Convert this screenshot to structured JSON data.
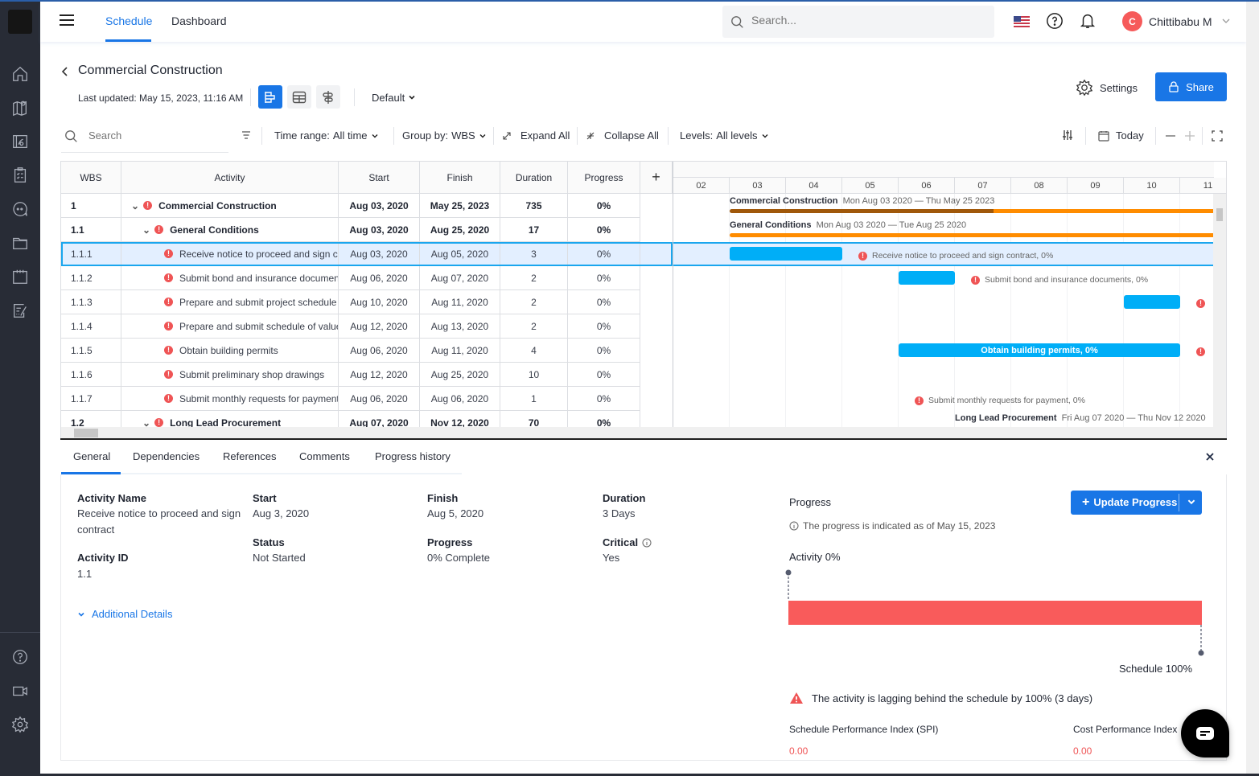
{
  "topnav": {
    "tabs": [
      {
        "label": "Schedule",
        "active": true
      },
      {
        "label": "Dashboard",
        "active": false
      }
    ],
    "search_placeholder": "Search...",
    "user": {
      "initial": "C",
      "name": "Chittibabu M"
    },
    "icons": [
      "flag-us-icon",
      "help-icon",
      "bell-icon"
    ]
  },
  "sidebar": {
    "items": [
      "home-icon",
      "map-icon",
      "blueprint-icon",
      "checklist-icon",
      "chat-icon",
      "folder-icon",
      "calendar-icon",
      "report-icon"
    ],
    "bottom_items": [
      "help-icon",
      "video-icon",
      "gear-icon"
    ]
  },
  "header": {
    "title": "Commercial Construction",
    "last_updated": "Last updated: May 15, 2023, 11:16 AM",
    "view_modes": [
      "gantt",
      "table",
      "timeline"
    ],
    "active_view": "gantt",
    "view_select": "Default",
    "settings_label": "Settings",
    "share_label": "Share"
  },
  "toolbar": {
    "search_placeholder": "Search",
    "time_range": {
      "label": "Time range:",
      "value": "All time"
    },
    "group_by": {
      "label": "Group by:",
      "value": "WBS"
    },
    "expand_all": "Expand All",
    "collapse_all": "Collapse All",
    "levels": {
      "label": "Levels:",
      "value": "All levels"
    },
    "today": "Today"
  },
  "table": {
    "columns": [
      "WBS",
      "Activity",
      "Start",
      "Finish",
      "Duration",
      "Progress"
    ],
    "rows": [
      {
        "wbs": "1",
        "activity": "Commercial Construction",
        "start": "Aug 03, 2020",
        "finish": "May 25, 2023",
        "duration": "735",
        "progress": "0%",
        "level": 0,
        "summary": true
      },
      {
        "wbs": "1.1",
        "activity": "General Conditions",
        "start": "Aug 03, 2020",
        "finish": "Aug 25, 2020",
        "duration": "17",
        "progress": "0%",
        "level": 1,
        "summary": true
      },
      {
        "wbs": "1.1.1",
        "activity": "Receive notice to proceed and sign contract",
        "start": "Aug 03, 2020",
        "finish": "Aug 05, 2020",
        "duration": "3",
        "progress": "0%",
        "level": 2,
        "selected": true
      },
      {
        "wbs": "1.1.2",
        "activity": "Submit bond and insurance documents",
        "start": "Aug 06, 2020",
        "finish": "Aug 07, 2020",
        "duration": "2",
        "progress": "0%",
        "level": 2
      },
      {
        "wbs": "1.1.3",
        "activity": "Prepare and submit project schedule",
        "start": "Aug 10, 2020",
        "finish": "Aug 11, 2020",
        "duration": "2",
        "progress": "0%",
        "level": 2
      },
      {
        "wbs": "1.1.4",
        "activity": "Prepare and submit schedule of values",
        "start": "Aug 12, 2020",
        "finish": "Aug 13, 2020",
        "duration": "2",
        "progress": "0%",
        "level": 2
      },
      {
        "wbs": "1.1.5",
        "activity": "Obtain building permits",
        "start": "Aug 06, 2020",
        "finish": "Aug 11, 2020",
        "duration": "4",
        "progress": "0%",
        "level": 2
      },
      {
        "wbs": "1.1.6",
        "activity": "Submit preliminary shop drawings",
        "start": "Aug 12, 2020",
        "finish": "Aug 25, 2020",
        "duration": "10",
        "progress": "0%",
        "level": 2
      },
      {
        "wbs": "1.1.7",
        "activity": "Submit monthly requests for payment",
        "start": "Aug 06, 2020",
        "finish": "Aug 06, 2020",
        "duration": "1",
        "progress": "0%",
        "level": 2
      },
      {
        "wbs": "1.2",
        "activity": "Long Lead Procurement",
        "start": "Aug 07, 2020",
        "finish": "Nov 12, 2020",
        "duration": "70",
        "progress": "0%",
        "level": 1,
        "summary": true
      }
    ]
  },
  "gantt": {
    "days": [
      "02",
      "03",
      "04",
      "05",
      "06",
      "07",
      "08",
      "09",
      "10",
      "11"
    ],
    "labels": {
      "cc_name": "Commercial Construction",
      "cc_dates": "Mon Aug 03 2020 — Thu May 25 2023",
      "gc_name": "General Conditions",
      "gc_dates": "Mon Aug 03 2020 — Tue Aug 25 2020",
      "t1": "Receive notice to proceed and sign contract, 0%",
      "t2": "Submit bond and insurance documents, 0%",
      "t5": "Obtain building permits, 0%",
      "t7": "Submit monthly requests for payment, 0%",
      "llp_name": "Long Lead Procurement",
      "llp_dates": "Fri Aug 07 2020 — Thu Nov 12 2020"
    }
  },
  "details": {
    "tabs": [
      "General",
      "Dependencies",
      "References",
      "Comments",
      "Progress history"
    ],
    "active_tab": "General",
    "fields": {
      "activity_name_label": "Activity Name",
      "activity_name": "Receive notice to proceed and sign contract",
      "activity_id_label": "Activity ID",
      "activity_id": "1.1",
      "start_label": "Start",
      "start": "Aug 3, 2020",
      "status_label": "Status",
      "status": "Not Started",
      "finish_label": "Finish",
      "finish": "Aug 5, 2020",
      "progress_label": "Progress",
      "progress": "0% Complete",
      "duration_label": "Duration",
      "duration": "3 Days",
      "critical_label": "Critical",
      "critical": "Yes"
    },
    "additional_details": "Additional Details",
    "progress_panel": {
      "title": "Progress",
      "note": "The progress is indicated as of May 15, 2023",
      "update_btn": "Update Progress",
      "activity_label": "Activity 0%",
      "activity_pct": 0,
      "schedule_label": "Schedule 100%",
      "schedule_pct": 100,
      "lag_message": "The activity is lagging behind the schedule by 100% (3 days)",
      "spi_label": "Schedule Performance Index (SPI)",
      "spi_value": "0.00",
      "cpi_label": "Cost Performance Index",
      "cpi_value": "0.00"
    }
  },
  "colors": {
    "accent": "#1976e6",
    "warning": "#ef5455",
    "task_bar": "#00aef7",
    "summary_bar": "#ff8c00",
    "summary_progress": "#a0580a",
    "lag_bar": "#f95b5b"
  }
}
